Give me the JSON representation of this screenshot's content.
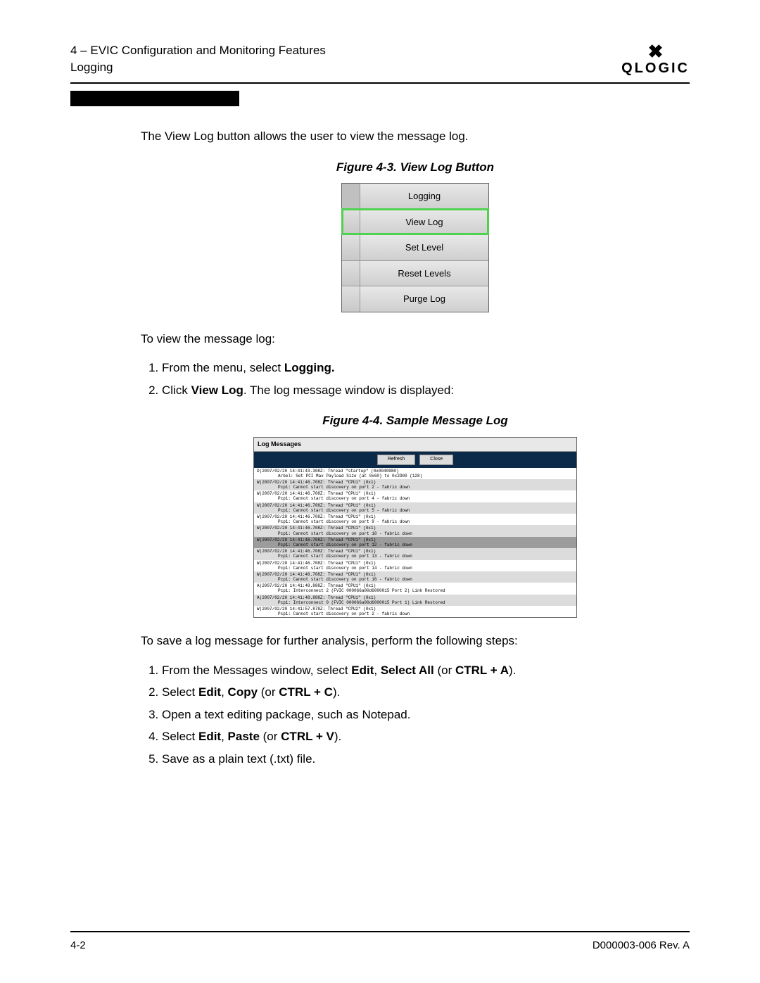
{
  "header": {
    "chapter": "4 – EVIC Configuration and Monitoring Features",
    "section": "Logging",
    "brand": "QLOGIC"
  },
  "intro": "The View Log button allows the user to view the message log.",
  "figure1": {
    "caption": "Figure 4-3. View Log Button",
    "items": [
      "Logging",
      "View Log",
      "Set Level",
      "Reset Levels",
      "Purge Log"
    ]
  },
  "toView": "To view the message log:",
  "steps1": {
    "s1a": "From the menu, select ",
    "s1b": "Logging.",
    "s2a": "Click ",
    "s2b": "View Log",
    "s2c": ". The log message window is displayed:"
  },
  "figure2": {
    "caption": "Figure 4-4. Sample Message Log",
    "title": "Log Messages",
    "btnRefresh": "Refresh",
    "btnClose": "Close",
    "entries": [
      {
        "shade": "",
        "l1": "D|2007/02/20 14:41:43.308Z: Thread \"startup\" (0x0040980)",
        "l2": "Arbel: Set PCI Max Payload Size (at 0x60) to 0x2D00 (128)"
      },
      {
        "shade": "gray",
        "l1": "W|2007/02/20 14:41:46.708Z: Thread \"CPU1\" (0x1)",
        "l2": "Pcp1: Cannot start discovery on port 2 - fabric down"
      },
      {
        "shade": "",
        "l1": "W|2007/02/20 14:41:46.708Z: Thread \"CPU1\" (0x1)",
        "l2": "Pcp1: Cannot start discovery on port 4 - fabric down"
      },
      {
        "shade": "gray",
        "l1": "W|2007/02/20 14:41:46.708Z: Thread \"CPU1\" (0x1)",
        "l2": "Pcp1: Cannot start discovery on port 5 - fabric down"
      },
      {
        "shade": "",
        "l1": "W|2007/02/20 14:41:46.708Z: Thread \"CPU1\" (0x1)",
        "l2": "Pcp1: Cannot start discovery on port 9 - fabric down"
      },
      {
        "shade": "gray",
        "l1": "W|2007/02/20 14:41:46.708Z: Thread \"CPU1\" (0x1)",
        "l2": "Pcp1: Cannot start discovery on port 10 - fabric down"
      },
      {
        "shade": "darkgray",
        "l1": "W|2007/02/20 14:41:46.708Z: Thread \"CPU1\" (0x1)",
        "l2": "Pcp1: Cannot start discovery on port 12 - fabric down"
      },
      {
        "shade": "gray",
        "l1": "W|2007/02/20 14:41:46.708Z: Thread \"CPU1\" (0x1)",
        "l2": "Pcp1: Cannot start discovery on port 13 - fabric down"
      },
      {
        "shade": "",
        "l1": "W|2007/02/20 14:41:46.708Z: Thread \"CPU1\" (0x1)",
        "l2": "Pcp1: Cannot start discovery on port 14 - fabric down"
      },
      {
        "shade": "gray",
        "l1": "W|2007/02/20 14:41:46.708Z: Thread \"CPU1\" (0x1)",
        "l2": "Pcp1: Cannot start discovery on port 16 - fabric down"
      },
      {
        "shade": "",
        "l1": "A|2007/02/20 14:41:48.888Z: Thread \"CPU1\" (0x1)",
        "l2": "Pcp1: Interconnect 2 (FVIC 000066a00d6000015 Port 2) Link Restored"
      },
      {
        "shade": "gray",
        "l1": "A|2007/02/20 14:41:48.888Z: Thread \"CPU1\" (0x1)",
        "l2": "Pcp1: Interconnect 0 (FVIC 000066a00d6000015 Port 1) Link Restored"
      },
      {
        "shade": "",
        "l1": "W|2007/02/20 14:41:57.878Z: Thread \"CPU2\" (0x1)",
        "l2": "Pcp1: Cannot start discovery on port 2 - fabric down"
      }
    ]
  },
  "toSave": "To save a log message for further analysis, perform the following steps:",
  "steps2": {
    "s1a": "From the Messages window, select ",
    "s1b": "Edit",
    "s1c": ", ",
    "s1d": "Select All",
    "s1e": " (or ",
    "s1f": "CTRL + A",
    "s1g": ").",
    "s2a": "Select ",
    "s2b": "Edit",
    "s2c": ", ",
    "s2d": "Copy",
    "s2e": " (or ",
    "s2f": "CTRL + C",
    "s2g": ").",
    "s3": "Open a text editing package, such as Notepad.",
    "s4a": "Select ",
    "s4b": "Edit",
    "s4c": ", ",
    "s4d": "Paste",
    "s4e": " (or ",
    "s4f": "CTRL + V",
    "s4g": ").",
    "s5": "Save as a plain text (.txt) file."
  },
  "footer": {
    "page": "4-2",
    "doc": "D000003-006 Rev. A"
  }
}
